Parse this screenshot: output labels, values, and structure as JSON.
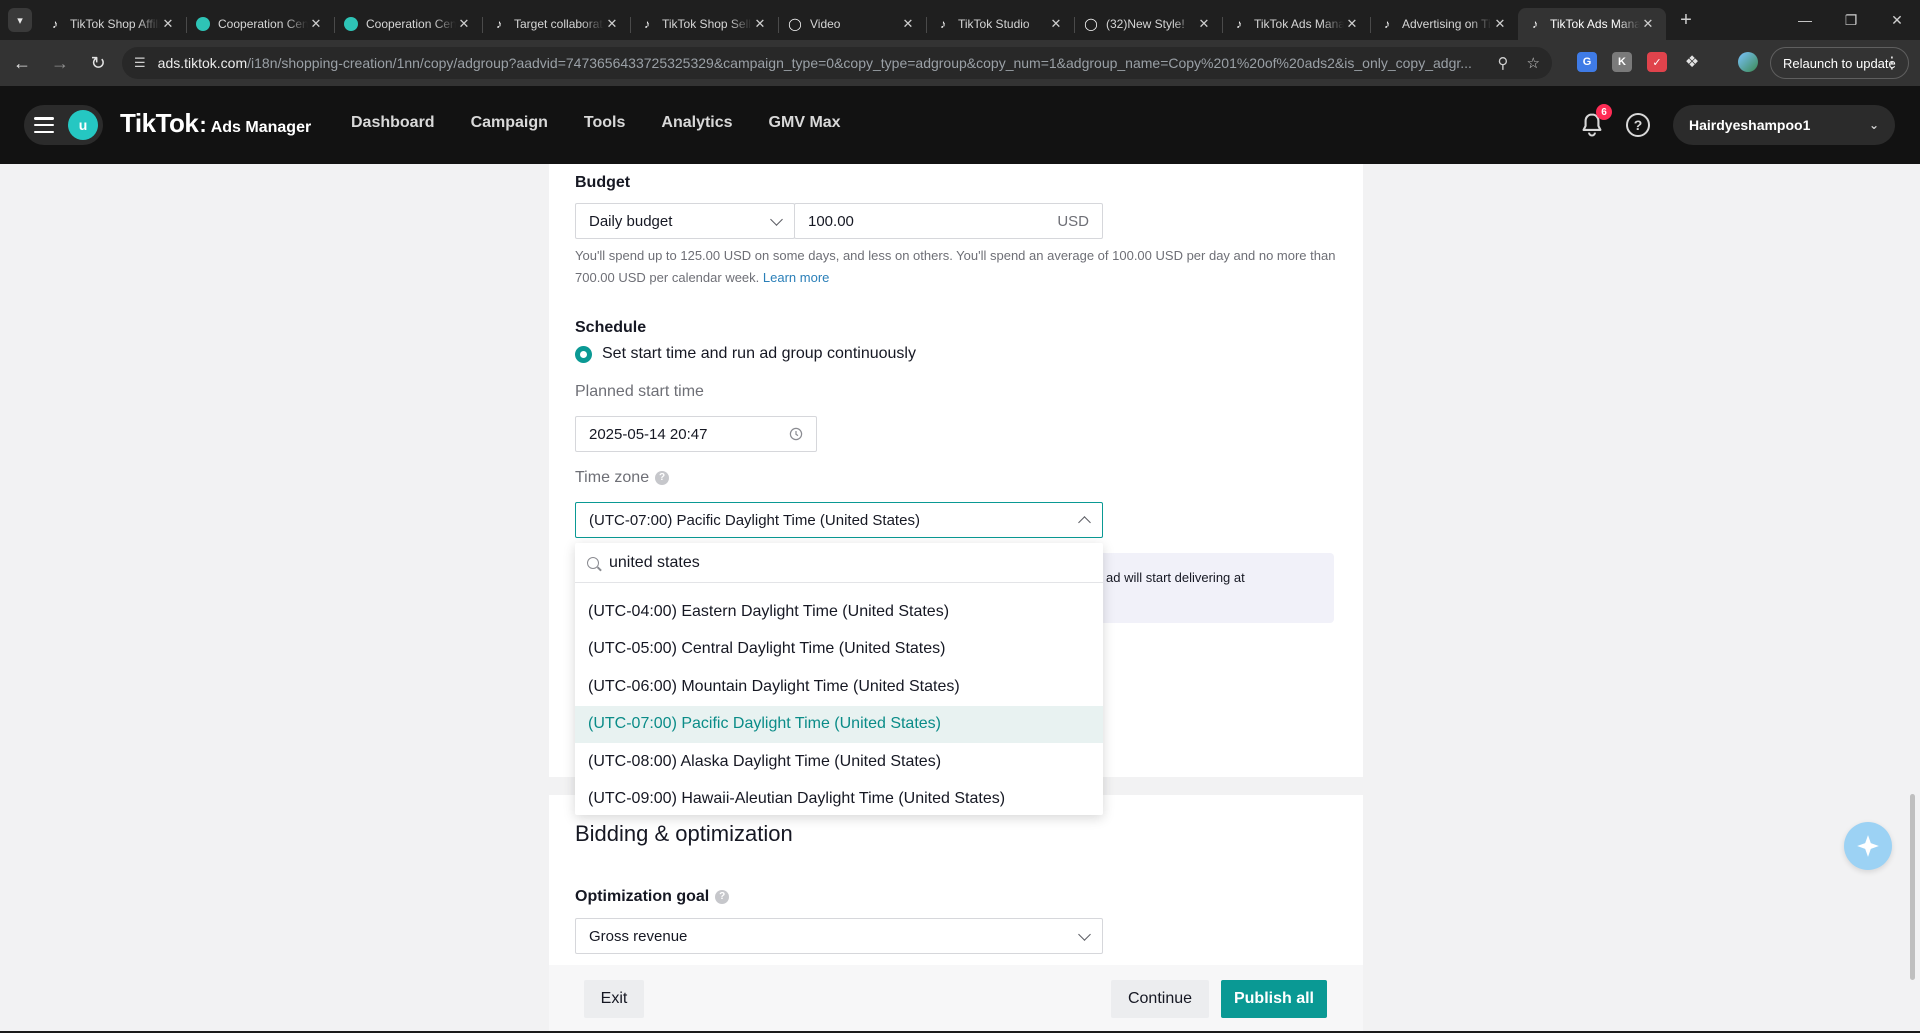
{
  "browser": {
    "tabs": [
      {
        "title": "TikTok Shop Affiliate",
        "icon": "tiktok-icon",
        "active": false
      },
      {
        "title": "Cooperation Center",
        "icon": "cooperation-icon",
        "active": false
      },
      {
        "title": "Cooperation Center",
        "icon": "cooperation-icon",
        "active": false
      },
      {
        "title": "Target collaboration",
        "icon": "tiktok-icon",
        "active": false
      },
      {
        "title": "TikTok Shop Seller",
        "icon": "tiktok-icon",
        "active": false
      },
      {
        "title": "Video",
        "icon": "tiktok-circle-icon",
        "active": false
      },
      {
        "title": "TikTok Studio",
        "icon": "tiktok-icon",
        "active": false
      },
      {
        "title": "(32)New Style!",
        "icon": "tiktok-circle-icon",
        "active": false
      },
      {
        "title": "TikTok Ads Manager",
        "icon": "tiktok-ads-icon",
        "active": false
      },
      {
        "title": "Advertising on TikTok",
        "icon": "tiktok-ads-icon",
        "active": false
      },
      {
        "title": "TikTok Ads Manager",
        "icon": "tiktok-ads-icon",
        "active": true
      }
    ],
    "url_host": "ads.tiktok.com",
    "url_path": "/i18n/shopping-creation/1nn/copy/adgroup?aadvid=7473656433725325329&campaign_type=0&copy_type=adgroup&copy_num=1&adgroup_name=Copy%201%20of%20ads2&is_only_copy_adgr...",
    "relaunch_label": "Relaunch to update"
  },
  "app": {
    "avatar_letter": "u",
    "brand": "TikTok",
    "brand_sub": "Ads Manager",
    "nav": [
      "Dashboard",
      "Campaign",
      "Tools",
      "Analytics",
      "GMV Max"
    ],
    "notification_count": "6",
    "account_name": "Hairdyeshampoo1"
  },
  "budget": {
    "label": "Budget",
    "type": "Daily budget",
    "amount": "100.00",
    "currency": "USD",
    "help_text": "You'll spend up to 125.00 USD on some days, and less on others. You'll spend an average of 100.00 USD per day and no more than 700.00 USD per calendar week.",
    "learn_more": "Learn more"
  },
  "schedule": {
    "label": "Schedule",
    "option_label": "Set start time and run ad group continuously",
    "start_label": "Planned start time",
    "start_value": "2025-05-14 20:47",
    "timezone_label": "Time zone",
    "timezone_value": "(UTC-07:00) Pacific Daylight Time (United States)",
    "notice_text": "ad will start delivering at"
  },
  "timezone_dropdown": {
    "search_value": "united states",
    "options": [
      {
        "label": "(UTC-04:00) Eastern Daylight Time (United States)",
        "selected": false
      },
      {
        "label": "(UTC-05:00) Central Daylight Time (United States)",
        "selected": false
      },
      {
        "label": "(UTC-06:00) Mountain Daylight Time (United States)",
        "selected": false
      },
      {
        "label": "(UTC-07:00) Pacific Daylight Time (United States)",
        "selected": true
      },
      {
        "label": "(UTC-08:00) Alaska Daylight Time (United States)",
        "selected": false
      },
      {
        "label": "(UTC-09:00) Hawaii-Aleutian Daylight Time (United States)",
        "selected": false
      }
    ]
  },
  "bidding": {
    "title": "Bidding & optimization",
    "goal_label": "Optimization goal",
    "goal_value": "Gross revenue"
  },
  "footer": {
    "exit_label": "Exit",
    "continue_label": "Continue",
    "publish_label": "Publish all"
  },
  "colors": {
    "accent": "#0a9994",
    "header_bg": "#121212",
    "badge": "#fe2c55"
  }
}
